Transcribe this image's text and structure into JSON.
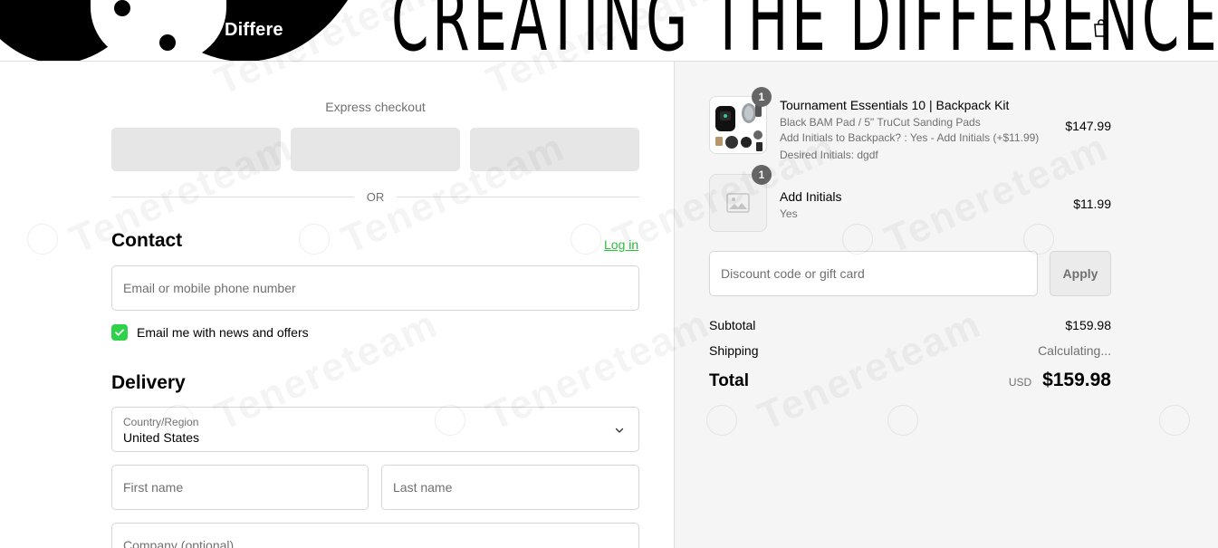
{
  "header": {
    "brand_stub": "Differe",
    "brand_name": "CREATING THE DIFFERENCE",
    "cart_icon": "shopping-bag-icon"
  },
  "express": {
    "title": "Express checkout",
    "or_label": "OR"
  },
  "contact": {
    "title": "Contact",
    "login_label": "Log in",
    "email_placeholder": "Email or mobile phone number",
    "newsletter_label": "Email me with news and offers",
    "newsletter_checked": true
  },
  "delivery": {
    "title": "Delivery",
    "country_label": "Country/Region",
    "country_value": "United States",
    "first_name_placeholder": "First name",
    "last_name_placeholder": "Last name",
    "company_placeholder": "Company (optional)"
  },
  "summary": {
    "items": [
      {
        "qty": "1",
        "title": "Tournament Essentials 10 | Backpack Kit",
        "variant": "Black BAM Pad / 5\" TruCut Sanding Pads",
        "option": "Add Initials to Backpack? : Yes - Add Initials (+$11.99)",
        "extra": "Desired Initials: dgdf",
        "price": "$147.99"
      },
      {
        "qty": "1",
        "title": "Add Initials",
        "variant": "Yes",
        "price": "$11.99"
      }
    ],
    "discount_placeholder": "Discount code or gift card",
    "apply_label": "Apply",
    "subtotal_label": "Subtotal",
    "subtotal_value": "$159.98",
    "shipping_label": "Shipping",
    "shipping_value": "Calculating...",
    "total_label": "Total",
    "currency": "USD",
    "total_value": "$159.98"
  },
  "watermark": {
    "text": "Tenereteam"
  },
  "colors": {
    "accent_green": "#2fd04a",
    "link_green": "#2bbf3a",
    "summary_bg": "#f5f5f5"
  }
}
